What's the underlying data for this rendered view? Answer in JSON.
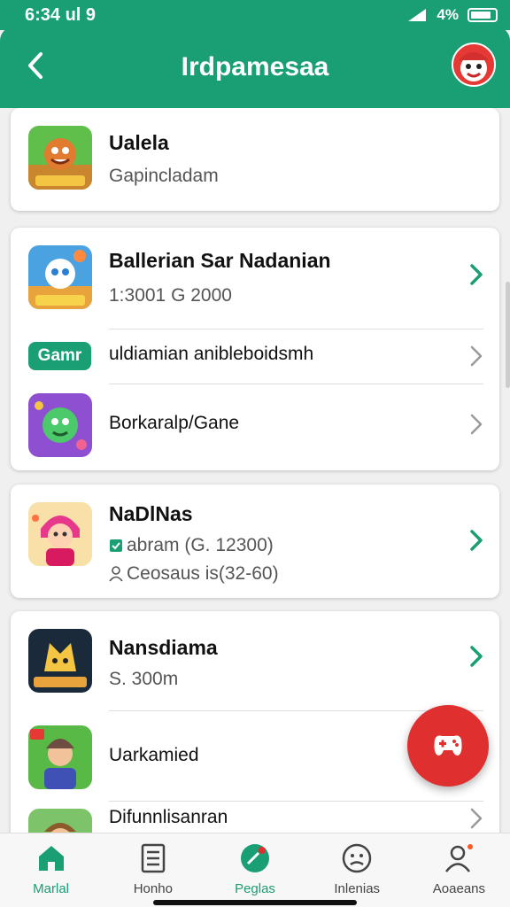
{
  "status": {
    "time": "6:34 ul 9",
    "battery": "4%"
  },
  "header": {
    "title": "Irdpamesaa",
    "back_icon": "chevron-left-icon",
    "avatar_icon": "mascot-avatar-icon"
  },
  "cards": [
    {
      "title": "Ualela",
      "subtitle": "Gapincladam"
    },
    {
      "title": "Ballerian Sar Nadanian",
      "subtitle": "1:3001 G 2000",
      "rows": [
        {
          "pill": "Gamr",
          "label": "uldiamian anibleboidsmh"
        },
        {
          "label": "Borkaralp/Gane"
        }
      ]
    },
    {
      "title": "NaDlNas",
      "line1": "abram (G. 12300)",
      "line2": "Ceosaus is(32-60)"
    },
    {
      "title": "Nansdiama",
      "subtitle": "S. 300m",
      "rows": [
        {
          "label": "Uarkamied"
        },
        {
          "label": "Difunnlisanran"
        }
      ]
    }
  ],
  "fab_icon": "game-controller-icon",
  "nav": [
    {
      "label": "Marlal",
      "icon": "home-icon",
      "active": true
    },
    {
      "label": "Honho",
      "icon": "document-icon",
      "active": false
    },
    {
      "label": "Peglas",
      "icon": "badge-icon",
      "active": true
    },
    {
      "label": "Inlenias",
      "icon": "face-icon",
      "active": false
    },
    {
      "label": "Aoaeans",
      "icon": "profile-icon",
      "active": false
    }
  ],
  "colors": {
    "primary": "#1a9e74",
    "accent": "#e02f2f",
    "chevron_active": "#1a9e74",
    "chevron_inactive": "#999999"
  }
}
